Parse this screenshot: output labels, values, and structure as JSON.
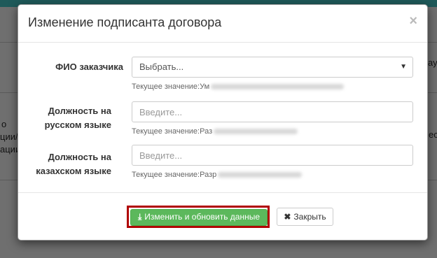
{
  "modal": {
    "title": "Изменение подписанта договора",
    "close_glyph": "×"
  },
  "form": {
    "customer_name": {
      "label": "ФИО заказчика",
      "value": "Выбрать...",
      "help_prefix": "Текущее значение:Ум"
    },
    "position_ru": {
      "label_line1": "Должность на",
      "label_line2": "русском языке",
      "placeholder": "Введите...",
      "help_prefix": "Текущее значение:Раз"
    },
    "position_kz": {
      "label_line1": "Должность на",
      "label_line2": "казахском языке",
      "placeholder": "Введите...",
      "help_prefix": "Текущее значение:Разр"
    }
  },
  "footer": {
    "submit_label": "Изменить и обновить данные",
    "submit_icon": "download-icon",
    "close_label": "Закрыть",
    "close_icon": "close-icon"
  },
  "background": {
    "text_a": "о",
    "text_b": "ции/",
    "text_c": "ации",
    "text_d": "ау",
    "text_e": "ес"
  },
  "colors": {
    "success": "#5cb85c",
    "highlight": "#b00000",
    "backdrop": "#6f6f6f"
  }
}
